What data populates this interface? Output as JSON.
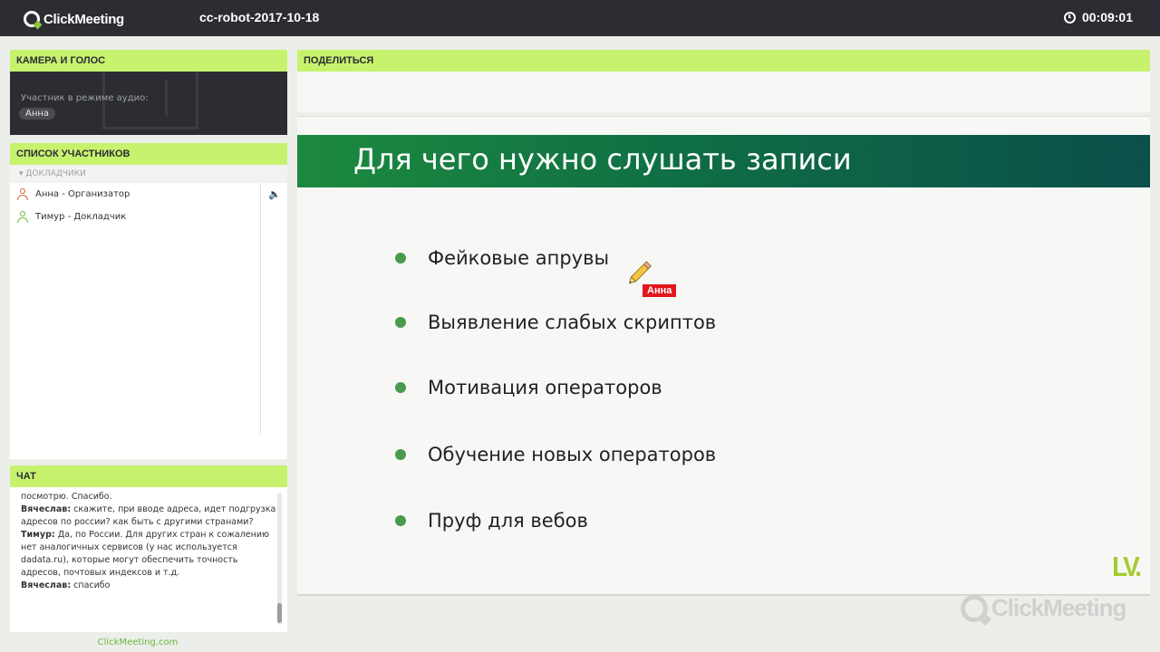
{
  "app": {
    "brand": "ClickMeeting",
    "meeting_title": "cc-robot-2017-10-18",
    "timer": "00:09:01"
  },
  "camera": {
    "header": "КАМЕРА И ГОЛОС",
    "audio_label": "Участник в режиме аудио:",
    "participant_name": "Анна"
  },
  "participants": {
    "header": "СПИСОК УЧАСТНИКОВ",
    "group_label": "ДОКЛАДЧИКИ",
    "items": [
      {
        "label": "Анна - Организатор",
        "role": "organizer"
      },
      {
        "label": "Тимур - Докладчик",
        "role": "presenter"
      }
    ]
  },
  "chat": {
    "header": "ЧАТ",
    "messages": [
      {
        "author": "",
        "text": "посмотрю. Спасибо."
      },
      {
        "author": "Вячеслав:",
        "text": " скажите, при вводе адреса, идет подгрузка адресов по россии? как быть с другими странами?"
      },
      {
        "author": "Тимур:",
        "text": " Да, по России. Для других стран к сожалению нет аналогичных сервисов (у нас используется dadata.ru), которые могут обеспечить точность адресов, почтовых индексов и т.д."
      },
      {
        "author": "Вячеслав:",
        "text": " спасибо"
      }
    ],
    "footer_link": "ClickMeeting.com"
  },
  "share": {
    "header": "ПОДЕЛИТЬСЯ",
    "slide_title": "Для чего нужно слушать записи",
    "bullets": [
      "Фейковые апрувы",
      "Выявление слабых скриптов",
      "Мотивация операторов",
      "Обучение новых операторов",
      "Пруф для вебов"
    ],
    "cursor_label": "Анна",
    "slide_logo": "LV.",
    "watermark": "ClickMeeting"
  },
  "colors": {
    "topbar": "#2b2d33",
    "panel_header": "#c7f26e",
    "bullet": "#4a9a4c",
    "cursor_label": "#e3161c",
    "link": "#6ab83a"
  },
  "icons": {
    "clock": "clock-icon",
    "organizer": "user-organizer-icon",
    "presenter": "user-presenter-icon",
    "speaker": "speaker-icon",
    "pencil": "pencil-icon"
  }
}
